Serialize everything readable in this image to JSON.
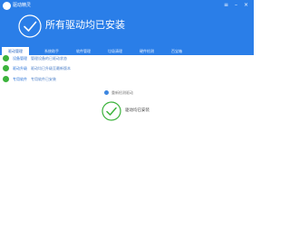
{
  "app": {
    "title": "驱动精灵"
  },
  "banner": {
    "text": "所有驱动均已安装"
  },
  "tabs": [
    {
      "label": "驱动管理"
    },
    {
      "label": "系统助手"
    },
    {
      "label": "软件管理"
    },
    {
      "label": "垃圾清理"
    },
    {
      "label": "硬件检测"
    },
    {
      "label": "百宝箱"
    }
  ],
  "items": [
    {
      "name": "设备管理",
      "desc": "管理设备的已驱动状态"
    },
    {
      "name": "驱动升级",
      "desc": "驱动均已升级至最新版本"
    },
    {
      "name": "专用软件",
      "desc": "专用软件已安装"
    }
  ],
  "refresh": {
    "text": "重新检测驱动"
  },
  "status": {
    "text": "驱动均已安装"
  },
  "colors": {
    "accent": "#2a7ee8",
    "success": "#3cb33c"
  }
}
